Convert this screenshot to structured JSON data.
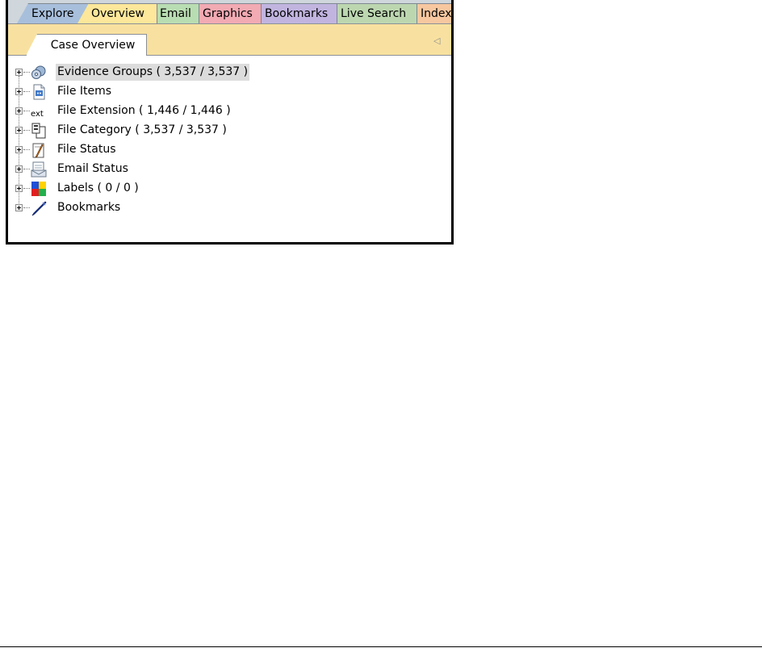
{
  "tabs": {
    "explore": "Explore",
    "overview": "Overview",
    "email": "Email",
    "graphics": "Graphics",
    "bookmarks": "Bookmarks",
    "live_search": "Live Search",
    "index": "Index"
  },
  "subtab": {
    "case_overview": "Case Overview",
    "scroll_glyph": "◁"
  },
  "tree": [
    {
      "label": "Evidence Groups ( 3,537 / 3,537 )",
      "icon": "evidence-groups-icon",
      "selected": true
    },
    {
      "label": "File Items",
      "icon": "file-items-icon"
    },
    {
      "label": "File Extension ( 1,446 / 1,446 )",
      "icon": "ext-icon",
      "icon_text": "ext"
    },
    {
      "label": "File Category ( 3,537 / 3,537 )",
      "icon": "file-category-icon"
    },
    {
      "label": "File Status",
      "icon": "file-status-icon"
    },
    {
      "label": "Email Status",
      "icon": "email-status-icon"
    },
    {
      "label": "Labels ( 0 / 0 )",
      "icon": "labels-icon"
    },
    {
      "label": "Bookmarks",
      "icon": "bookmarks-icon"
    }
  ],
  "colors": {
    "explore_tab": "#a8bfdc",
    "overview_tab": "#fce79a",
    "email_tab": "#b9ddb2",
    "graphics_tab": "#f2aab3",
    "bookmarks_tab": "#c1b5e0",
    "live_search_tab": "#bcd7b0",
    "index_tab": "#f7c7a0",
    "selection": "#dcdcdc"
  }
}
